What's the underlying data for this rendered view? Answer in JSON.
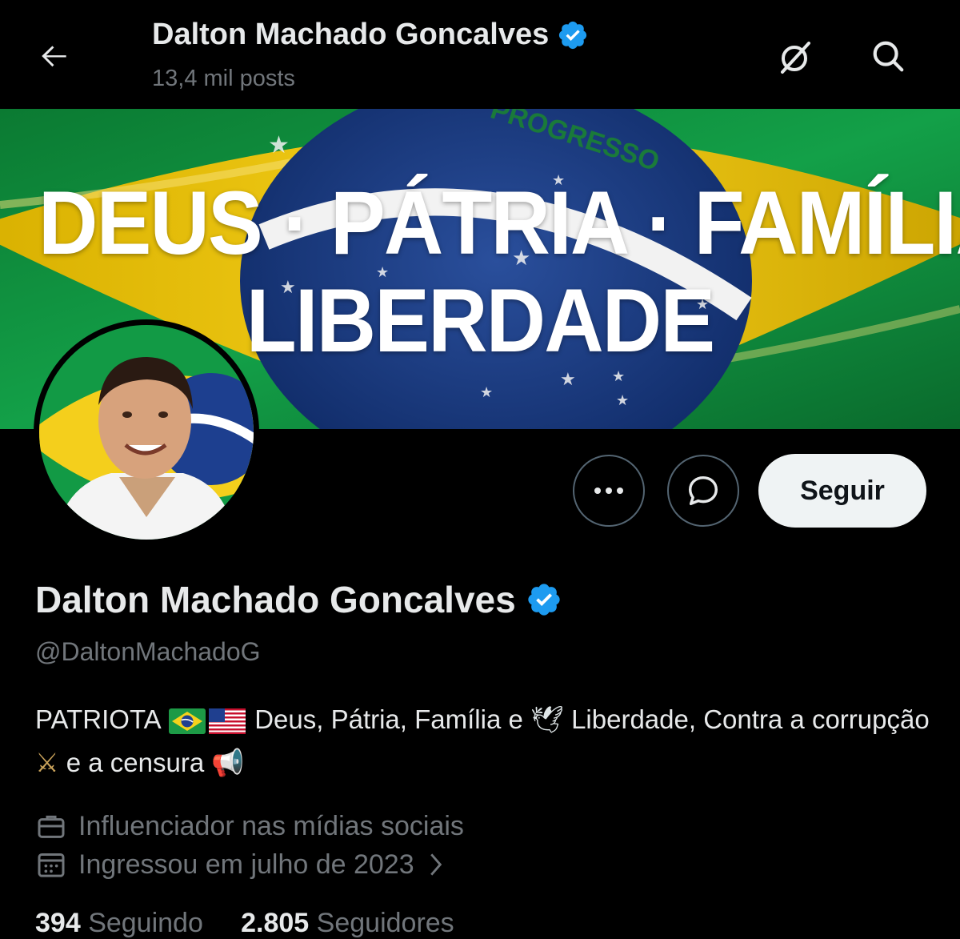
{
  "header": {
    "title": "Dalton Machado Goncalves",
    "posts_count": "13,4 mil posts"
  },
  "banner": {
    "line1": "DEUS · PÁTRIA · FAMÍLIA",
    "line2": "LIBERDADE",
    "flag_text": "PROGRESSO"
  },
  "actions": {
    "follow_label": "Seguir"
  },
  "profile": {
    "name": "Dalton Machado Goncalves",
    "handle": "@DaltonMachadoG",
    "bio_part1": "PATRIOTA",
    "bio_part2": "Deus, Pátria, Família e",
    "bio_part3": "Liberdade, Contra a corrupção",
    "bio_part4": "e a censura",
    "emoji_dove": "🕊",
    "emoji_swords": "⚔",
    "emoji_megaphone": "📢",
    "category": "Influenciador nas mídias sociais",
    "joined": "Ingressou em julho de 2023",
    "following_count": "394",
    "following_label": "Seguindo",
    "followers_count": "2.805",
    "followers_label": "Seguidores"
  },
  "icons": {
    "back": "arrow-left-icon",
    "grok": "grok-icon",
    "search": "search-icon",
    "verified": "verified-badge-icon",
    "more": "more-dots-icon",
    "message": "message-icon",
    "briefcase": "briefcase-icon",
    "calendar": "calendar-icon",
    "chevron": "chevron-right-icon"
  },
  "colors": {
    "background": "#000000",
    "text_primary": "#e7e9ea",
    "text_secondary": "#71767b",
    "verified_blue": "#1d9bf0",
    "follow_button_bg": "#eff3f4",
    "border": "#536471"
  }
}
